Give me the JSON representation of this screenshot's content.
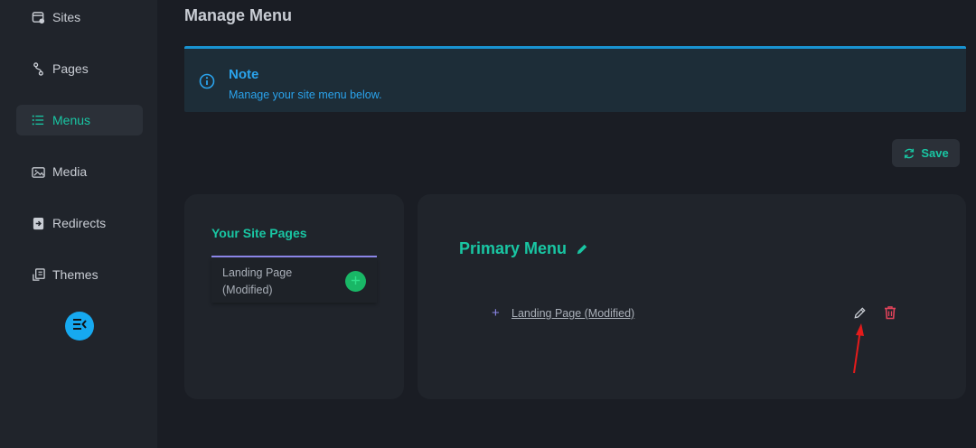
{
  "sidebar": {
    "items": [
      {
        "label": "Sites",
        "icon": "sites-icon"
      },
      {
        "label": "Pages",
        "icon": "pages-icon"
      },
      {
        "label": "Menus",
        "icon": "menus-icon",
        "active": true
      },
      {
        "label": "Media",
        "icon": "media-icon"
      },
      {
        "label": "Redirects",
        "icon": "redirects-icon"
      },
      {
        "label": "Themes",
        "icon": "themes-icon"
      }
    ],
    "collapse_icon": "collapse-sidebar-icon"
  },
  "header": {
    "title": "Manage Menu"
  },
  "note": {
    "title": "Note",
    "text": "Manage your site menu below.",
    "icon": "info-icon"
  },
  "toolbar": {
    "save_label": "Save",
    "save_icon": "refresh-icon"
  },
  "site_pages": {
    "title": "Your Site Pages",
    "items": [
      {
        "label": "Landing Page (Modified)",
        "action_icon": "plus-icon"
      }
    ]
  },
  "menu": {
    "title": "Primary Menu",
    "title_icon": "pencil-icon",
    "items": [
      {
        "prefix": "+",
        "label": "Landing Page (Modified)",
        "edit_icon": "pencil-icon",
        "delete_icon": "trash-icon"
      }
    ]
  },
  "colors": {
    "accent": "#19c6a3",
    "info": "#2aa3ec",
    "danger": "#e0435a",
    "success": "#19b766",
    "divider": "#8c87e8",
    "annotation_arrow": "#e41b1b"
  }
}
